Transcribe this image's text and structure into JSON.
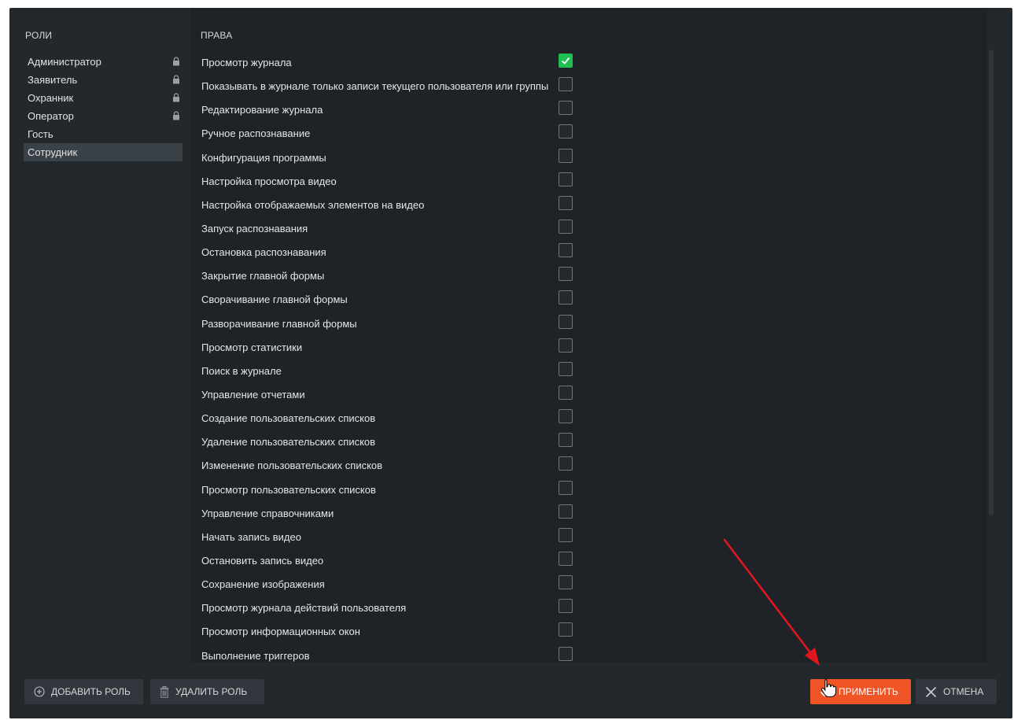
{
  "roles": {
    "header": "РОЛИ",
    "items": [
      {
        "label": "Администратор",
        "locked": true,
        "selected": false
      },
      {
        "label": "Заявитель",
        "locked": true,
        "selected": false
      },
      {
        "label": "Охранник",
        "locked": true,
        "selected": false
      },
      {
        "label": "Оператор",
        "locked": true,
        "selected": false
      },
      {
        "label": "Гость",
        "locked": false,
        "selected": false
      },
      {
        "label": "Сотрудник",
        "locked": false,
        "selected": true
      }
    ]
  },
  "rights": {
    "header": "ПРАВА",
    "items": [
      {
        "label": "Просмотр журнала",
        "checked": true
      },
      {
        "label": "Показывать в журнале только записи текущего пользователя или группы",
        "checked": false
      },
      {
        "label": "Редактирование журнала",
        "checked": false
      },
      {
        "label": "Ручное распознавание",
        "checked": false
      },
      {
        "label": "Конфигурация программы",
        "checked": false
      },
      {
        "label": "Настройка просмотра видео",
        "checked": false
      },
      {
        "label": "Настройка отображаемых элементов на видео",
        "checked": false
      },
      {
        "label": "Запуск распознавания",
        "checked": false
      },
      {
        "label": "Остановка распознавания",
        "checked": false
      },
      {
        "label": "Закрытие главной формы",
        "checked": false
      },
      {
        "label": "Сворачивание главной формы",
        "checked": false
      },
      {
        "label": "Разворачивание главной формы",
        "checked": false
      },
      {
        "label": "Просмотр статистики",
        "checked": false
      },
      {
        "label": "Поиск в журнале",
        "checked": false
      },
      {
        "label": "Управление отчетами",
        "checked": false
      },
      {
        "label": "Создание пользовательских списков",
        "checked": false
      },
      {
        "label": "Удаление пользовательских списков",
        "checked": false
      },
      {
        "label": "Изменение пользовательских списков",
        "checked": false
      },
      {
        "label": "Просмотр пользовательских списков",
        "checked": false
      },
      {
        "label": "Управление справочниками",
        "checked": false
      },
      {
        "label": "Начать запись видео",
        "checked": false
      },
      {
        "label": "Остановить запись видео",
        "checked": false
      },
      {
        "label": "Сохранение изображения",
        "checked": false
      },
      {
        "label": "Просмотр журнала действий пользователя",
        "checked": false
      },
      {
        "label": "Просмотр информационных окон",
        "checked": false
      },
      {
        "label": "Выполнение триггеров",
        "checked": false
      }
    ]
  },
  "footer": {
    "add_role": "ДОБАВИТЬ РОЛЬ",
    "delete_role": "УДАЛИТЬ РОЛЬ",
    "apply": "ПРИМЕНИТЬ",
    "cancel": "ОТМЕНА"
  },
  "colors": {
    "accent": "#f05527",
    "check": "#1fbe51",
    "annotation_arrow": "#e0171f"
  },
  "icons": {
    "add": "plus-circle-icon",
    "delete": "trash-icon",
    "apply": "checkmark-icon",
    "cancel": "close-icon",
    "lock": "lock-icon",
    "cursor": "hand-pointer-icon"
  }
}
